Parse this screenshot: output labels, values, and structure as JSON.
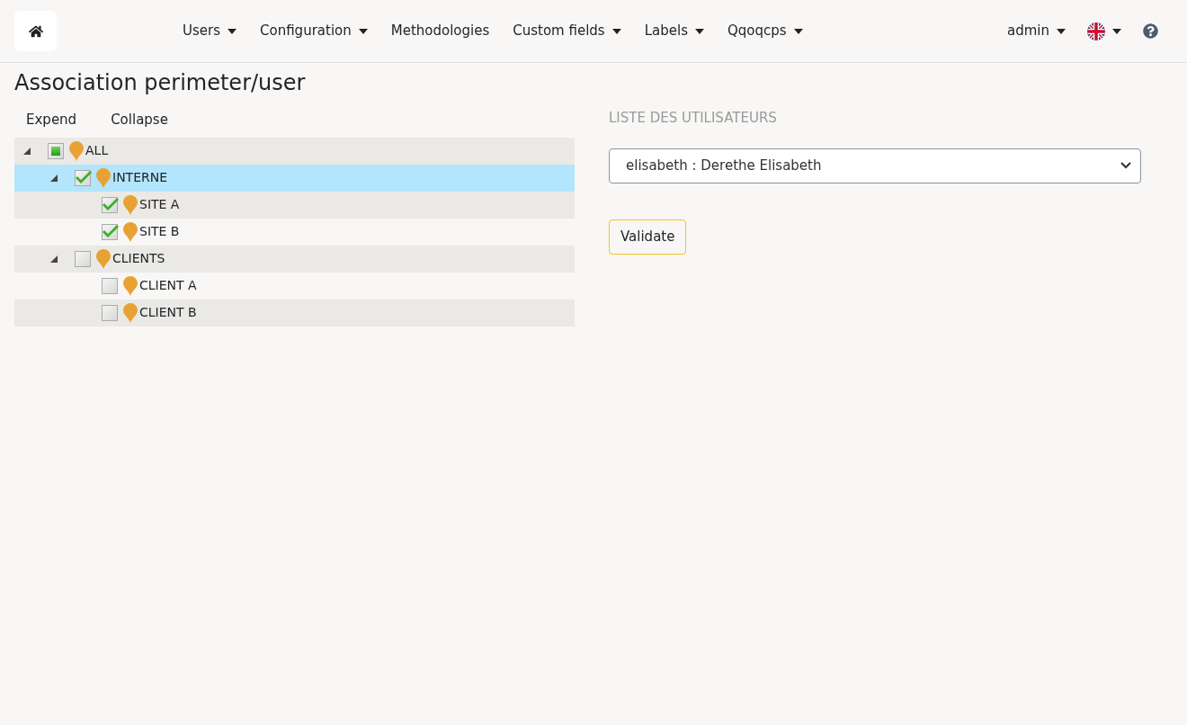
{
  "navbar": {
    "menus": [
      {
        "label": "Users",
        "dropdown": true
      },
      {
        "label": "Configuration",
        "dropdown": true
      },
      {
        "label": "Methodologies",
        "dropdown": false
      },
      {
        "label": "Custom fields",
        "dropdown": true
      },
      {
        "label": "Labels",
        "dropdown": true
      },
      {
        "label": "Qqoqcps",
        "dropdown": true
      }
    ],
    "user_menu": "admin"
  },
  "page_title": "Association perimeter/user",
  "tree_actions": [
    "Expend",
    "Collapse"
  ],
  "tree": [
    {
      "label": "ALL",
      "checked": false,
      "partial": true,
      "selected": false,
      "expanded": true,
      "children": [
        {
          "label": "INTERNE",
          "checked": true,
          "selected": true,
          "expanded": true,
          "children": [
            {
              "label": "SITE A",
              "checked": true,
              "selected": false
            },
            {
              "label": "SITE B",
              "checked": true,
              "selected": false
            }
          ]
        },
        {
          "label": "CLIENTS",
          "checked": false,
          "selected": false,
          "expanded": true,
          "children": [
            {
              "label": "CLIENT A",
              "checked": false,
              "selected": false
            },
            {
              "label": "CLIENT B",
              "checked": false,
              "selected": false
            }
          ]
        }
      ]
    }
  ],
  "user_list": {
    "heading": "LISTE DES UTILISATEURS",
    "value": "elisabeth : Derethe Elisabeth"
  },
  "validate_button": "Validate"
}
